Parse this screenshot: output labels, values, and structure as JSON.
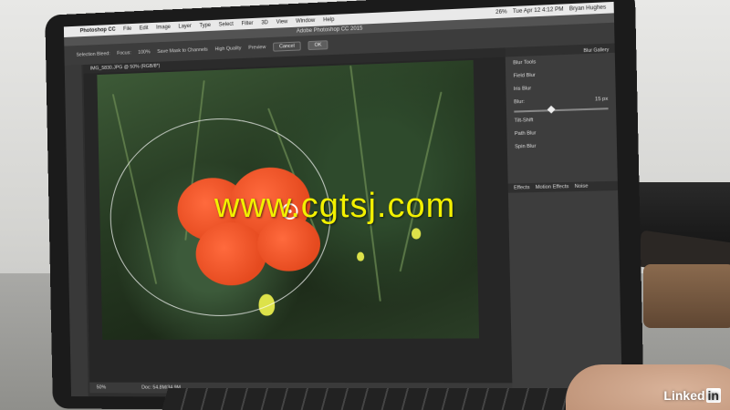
{
  "menubar": {
    "app_name": "Photoshop CC",
    "items": [
      "File",
      "Edit",
      "Image",
      "Layer",
      "Type",
      "Select",
      "Filter",
      "3D",
      "View",
      "Window",
      "Help"
    ],
    "battery": "26%",
    "datetime": "Tue Apr 12 4:12 PM",
    "user": "Bryan Hughes"
  },
  "window": {
    "title": "Adobe Photoshop CC 2015"
  },
  "options_bar": {
    "selection_bleed": "Selection Bleed:",
    "focus_label": "Focus:",
    "focus_value": "100%",
    "save_mask": "Save Mask to Channels",
    "high_quality": "High Quality",
    "preview": "Preview",
    "cancel": "Cancel",
    "ok": "OK"
  },
  "document": {
    "tab": "IMG_5830.JPG @ 50% (RGB/8*)",
    "zoom": "50%",
    "doc_size": "Doc: 54.8M/34.9M"
  },
  "panel": {
    "gallery": "Blur Gallery",
    "header": "Blur Tools",
    "items": [
      "Field Blur",
      "Iris Blur",
      "Tilt-Shift",
      "Path Blur",
      "Spin Blur"
    ],
    "blur_label": "Blur:",
    "blur_value": "15 px",
    "tabs": [
      "Effects",
      "Motion Effects",
      "Noise"
    ]
  },
  "watermark": "www.cgtsj.com",
  "logo": {
    "text": "Linked",
    "in": "in"
  }
}
